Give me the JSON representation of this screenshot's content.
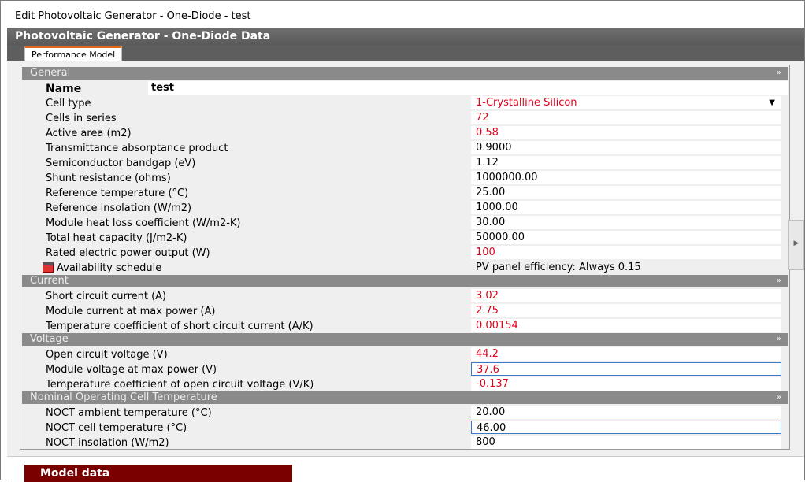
{
  "window": {
    "title": "Edit Photovoltaic Generator - One-Diode - test",
    "header": "Photovoltaic Generator - One-Diode Data",
    "tab": "Performance Model"
  },
  "sections": {
    "general": {
      "title": "General",
      "name_label": "Name",
      "name_value": "test",
      "cell_type_label": "Cell type",
      "cell_type_value": "1-Crystalline Silicon",
      "rows": [
        {
          "label": "Cells in series",
          "value": "72",
          "color": "#e0001c"
        },
        {
          "label": "Active area (m2)",
          "value": "0.58",
          "color": "#e0001c"
        },
        {
          "label": "Transmittance absorptance product",
          "value": "0.9000"
        },
        {
          "label": "Semiconductor bandgap (eV)",
          "value": "1.12"
        },
        {
          "label": "Shunt resistance (ohms)",
          "value": "1000000.00"
        },
        {
          "label": "Reference temperature (°C)",
          "value": "25.00"
        },
        {
          "label": "Reference insolation (W/m2)",
          "value": "1000.00"
        },
        {
          "label": "Module heat loss coefficient (W/m2-K)",
          "value": "30.00"
        },
        {
          "label": "Total heat capacity (J/m2-K)",
          "value": "50000.00"
        },
        {
          "label": "Rated electric power output (W)",
          "value": "100",
          "color": "#e0001c"
        }
      ],
      "availability_label": "Availability schedule",
      "availability_value": "PV panel efficiency: Always 0.15",
      "availability_icon": "calendar-icon"
    },
    "current": {
      "title": "Current",
      "rows": [
        {
          "label": "Short circuit current (A)",
          "value": "3.02",
          "color": "#e0001c"
        },
        {
          "label": "Module current at max power (A)",
          "value": "2.75",
          "color": "#e0001c"
        },
        {
          "label": "Temperature coefficient of short circuit current (A/K)",
          "value": "0.00154",
          "color": "#e0001c"
        }
      ]
    },
    "voltage": {
      "title": "Voltage",
      "rows": [
        {
          "label": "Open circuit voltage (V)",
          "value": "44.2",
          "color": "#e0001c"
        },
        {
          "label": "Module voltage at max power (V)",
          "value": "37.6",
          "color": "#e0001c"
        },
        {
          "label": "Temperature coefficient of open circuit voltage (V/K)",
          "value": "-0.137",
          "color": "#e0001c"
        }
      ]
    },
    "noct": {
      "title": "Nominal Operating Cell Temperature",
      "rows": [
        {
          "label": "NOCT ambient temperature (°C)",
          "value": "20.00"
        },
        {
          "label": "NOCT cell temperature (°C)",
          "value": "46.00"
        },
        {
          "label": "NOCT insolation (W/m2)",
          "value": "800"
        }
      ]
    }
  },
  "bottom": {
    "model_data": "Model data"
  },
  "colors": {
    "header": "#5e5e5e",
    "section": "#8a8a8a",
    "red_value": "#e0001c",
    "model_data_bg": "#7a0000",
    "tab_accent": "#e06a1a"
  }
}
